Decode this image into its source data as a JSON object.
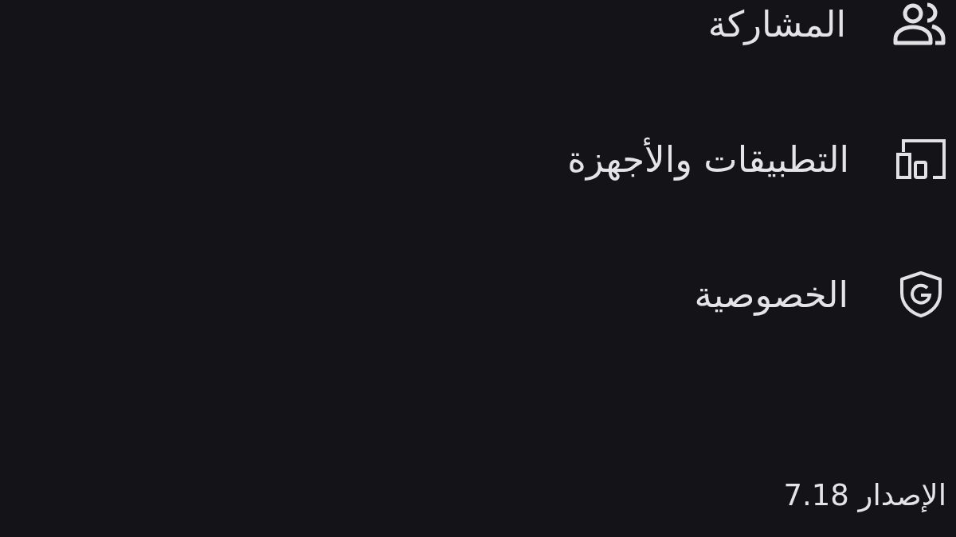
{
  "menu": {
    "items": [
      {
        "label": "المشاركة",
        "kind": "sharing"
      },
      {
        "label": "التطبيقات والأجهزة",
        "kind": "devices"
      },
      {
        "label": "الخصوصية",
        "kind": "privacy"
      }
    ]
  },
  "version": "الإصدار 7.18"
}
